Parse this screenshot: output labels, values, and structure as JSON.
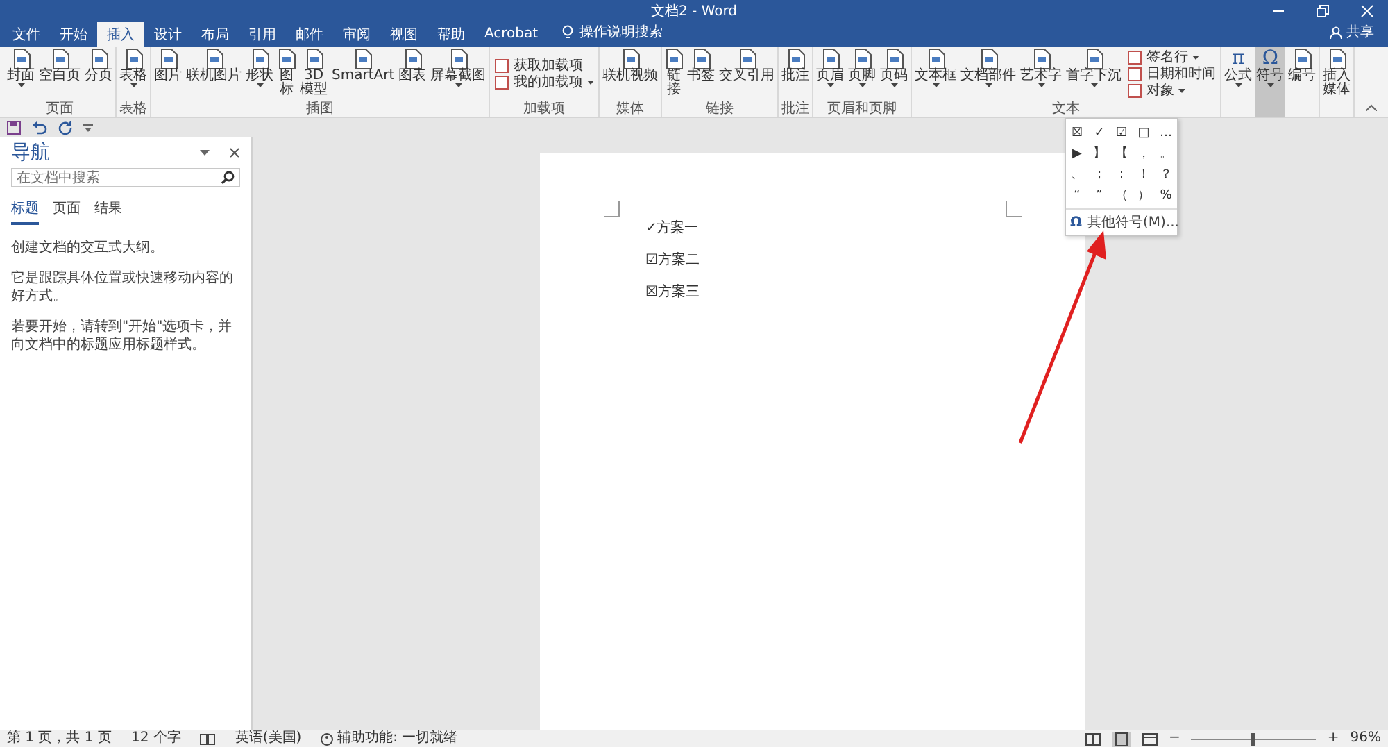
{
  "window": {
    "title": "文档2 - Word",
    "share": "共享"
  },
  "tabs": [
    {
      "label": "文件",
      "selected": false
    },
    {
      "label": "开始",
      "selected": false
    },
    {
      "label": "插入",
      "selected": true
    },
    {
      "label": "设计",
      "selected": false
    },
    {
      "label": "布局",
      "selected": false
    },
    {
      "label": "引用",
      "selected": false
    },
    {
      "label": "邮件",
      "selected": false
    },
    {
      "label": "审阅",
      "selected": false
    },
    {
      "label": "视图",
      "selected": false
    },
    {
      "label": "帮助",
      "selected": false
    },
    {
      "label": "Acrobat",
      "selected": false
    }
  ],
  "tell_me": "操作说明搜索",
  "ribbon_groups": [
    {
      "label": "页面",
      "items": [
        {
          "kind": "large",
          "lines": [
            "封面"
          ],
          "dropdown": true,
          "pressed": false
        },
        {
          "kind": "large",
          "lines": [
            "空白页"
          ],
          "dropdown": false,
          "pressed": false
        },
        {
          "kind": "large",
          "lines": [
            "分页"
          ],
          "dropdown": false,
          "pressed": false
        }
      ]
    },
    {
      "label": "表格",
      "items": [
        {
          "kind": "large",
          "lines": [
            "表格"
          ],
          "dropdown": true,
          "pressed": false
        }
      ]
    },
    {
      "label": "插图",
      "items": [
        {
          "kind": "large",
          "lines": [
            "图片"
          ],
          "dropdown": false,
          "pressed": false
        },
        {
          "kind": "large",
          "lines": [
            "联机图片"
          ],
          "dropdown": false,
          "pressed": false
        },
        {
          "kind": "large",
          "lines": [
            "形状"
          ],
          "dropdown": true,
          "pressed": false
        },
        {
          "kind": "large",
          "lines": [
            "图",
            "标"
          ],
          "dropdown": false,
          "pressed": false
        },
        {
          "kind": "large",
          "lines": [
            "3D",
            "模型"
          ],
          "dropdown": false,
          "pressed": false
        },
        {
          "kind": "large",
          "lines": [
            "SmartArt"
          ],
          "dropdown": false,
          "pressed": false
        },
        {
          "kind": "large",
          "lines": [
            "图表"
          ],
          "dropdown": false,
          "pressed": false
        },
        {
          "kind": "large",
          "lines": [
            "屏幕截图"
          ],
          "dropdown": true,
          "pressed": false
        }
      ]
    },
    {
      "label": "加载项",
      "items": [
        {
          "kind": "small",
          "lines": [
            "获取加载项"
          ],
          "dropdown": false,
          "pressed": false
        },
        {
          "kind": "small",
          "lines": [
            "我的加载项"
          ],
          "dropdown": true,
          "pressed": false
        }
      ]
    },
    {
      "label": "媒体",
      "items": [
        {
          "kind": "large",
          "lines": [
            "联机视频"
          ],
          "dropdown": false,
          "pressed": false
        }
      ]
    },
    {
      "label": "链接",
      "items": [
        {
          "kind": "large",
          "lines": [
            "链",
            "接"
          ],
          "dropdown": false,
          "pressed": false
        },
        {
          "kind": "large",
          "lines": [
            "书签"
          ],
          "dropdown": false,
          "pressed": false
        },
        {
          "kind": "large",
          "lines": [
            "交叉引用"
          ],
          "dropdown": false,
          "pressed": false
        }
      ]
    },
    {
      "label": "批注",
      "items": [
        {
          "kind": "large",
          "lines": [
            "批注"
          ],
          "dropdown": false,
          "pressed": false
        }
      ]
    },
    {
      "label": "页眉和页脚",
      "items": [
        {
          "kind": "large",
          "lines": [
            "页眉"
          ],
          "dropdown": true,
          "pressed": false
        },
        {
          "kind": "large",
          "lines": [
            "页脚"
          ],
          "dropdown": true,
          "pressed": false
        },
        {
          "kind": "large",
          "lines": [
            "页码"
          ],
          "dropdown": true,
          "pressed": false
        }
      ]
    },
    {
      "label": "文本",
      "items": [
        {
          "kind": "large",
          "lines": [
            "文本框"
          ],
          "dropdown": true,
          "pressed": false
        },
        {
          "kind": "large",
          "lines": [
            "文档部件"
          ],
          "dropdown": true,
          "pressed": false
        },
        {
          "kind": "large",
          "lines": [
            "艺术字"
          ],
          "dropdown": true,
          "pressed": false
        },
        {
          "kind": "large",
          "lines": [
            "首字下沉"
          ],
          "dropdown": true,
          "pressed": false
        },
        {
          "kind": "small",
          "lines": [
            "签名行"
          ],
          "dropdown": true,
          "pressed": false
        },
        {
          "kind": "small",
          "lines": [
            "日期和时间"
          ],
          "dropdown": false,
          "pressed": false
        },
        {
          "kind": "small",
          "lines": [
            "对象"
          ],
          "dropdown": true,
          "pressed": false
        }
      ]
    },
    {
      "items": [
        {
          "kind": "glyph",
          "glyph": "π",
          "lines": [
            "公式"
          ],
          "dropdown": true,
          "pressed": false
        },
        {
          "kind": "glyph",
          "glyph": "Ω",
          "lines": [
            "符号"
          ],
          "dropdown": true,
          "pressed": true
        },
        {
          "kind": "large",
          "lines": [
            "编号"
          ],
          "dropdown": false,
          "pressed": false
        }
      ]
    },
    {
      "items": [
        {
          "kind": "large",
          "lines": [
            "插入",
            "媒体"
          ],
          "dropdown": false,
          "pressed": false
        }
      ]
    }
  ],
  "symbol_menu": {
    "symbols": [
      "☒",
      "✓",
      "☑",
      "□",
      "…",
      "▶",
      "】",
      "【",
      "，",
      "。",
      "、",
      "；",
      "：",
      "！",
      "？",
      "“",
      "”",
      "（",
      "）",
      "%"
    ],
    "more_glyph": "Ω",
    "more_label": "其他符号(M)..."
  },
  "navigation": {
    "title": "导航",
    "search": {
      "placeholder": "在文档中搜索"
    },
    "tabs": [
      {
        "label": "标题",
        "selected": true
      },
      {
        "label": "页面",
        "selected": false
      },
      {
        "label": "结果",
        "selected": false
      }
    ],
    "paragraphs": [
      "创建文档的交互式大纲。",
      "它是跟踪具体位置或快速移动内容的好方式。",
      "若要开始，请转到\"开始\"选项卡，并向文档中的标题应用标题样式。"
    ]
  },
  "document": {
    "lines": [
      "✓方案一",
      "☑方案二",
      "☒方案三"
    ]
  },
  "status_bar": {
    "page": "第 1 页，共 1 页",
    "words": "12 个字",
    "language": "英语(美国)",
    "accessibility": "辅助功能: 一切就绪",
    "zoom": {
      "out": "−",
      "in": "+",
      "level": 0.48,
      "reading": "96%"
    }
  }
}
